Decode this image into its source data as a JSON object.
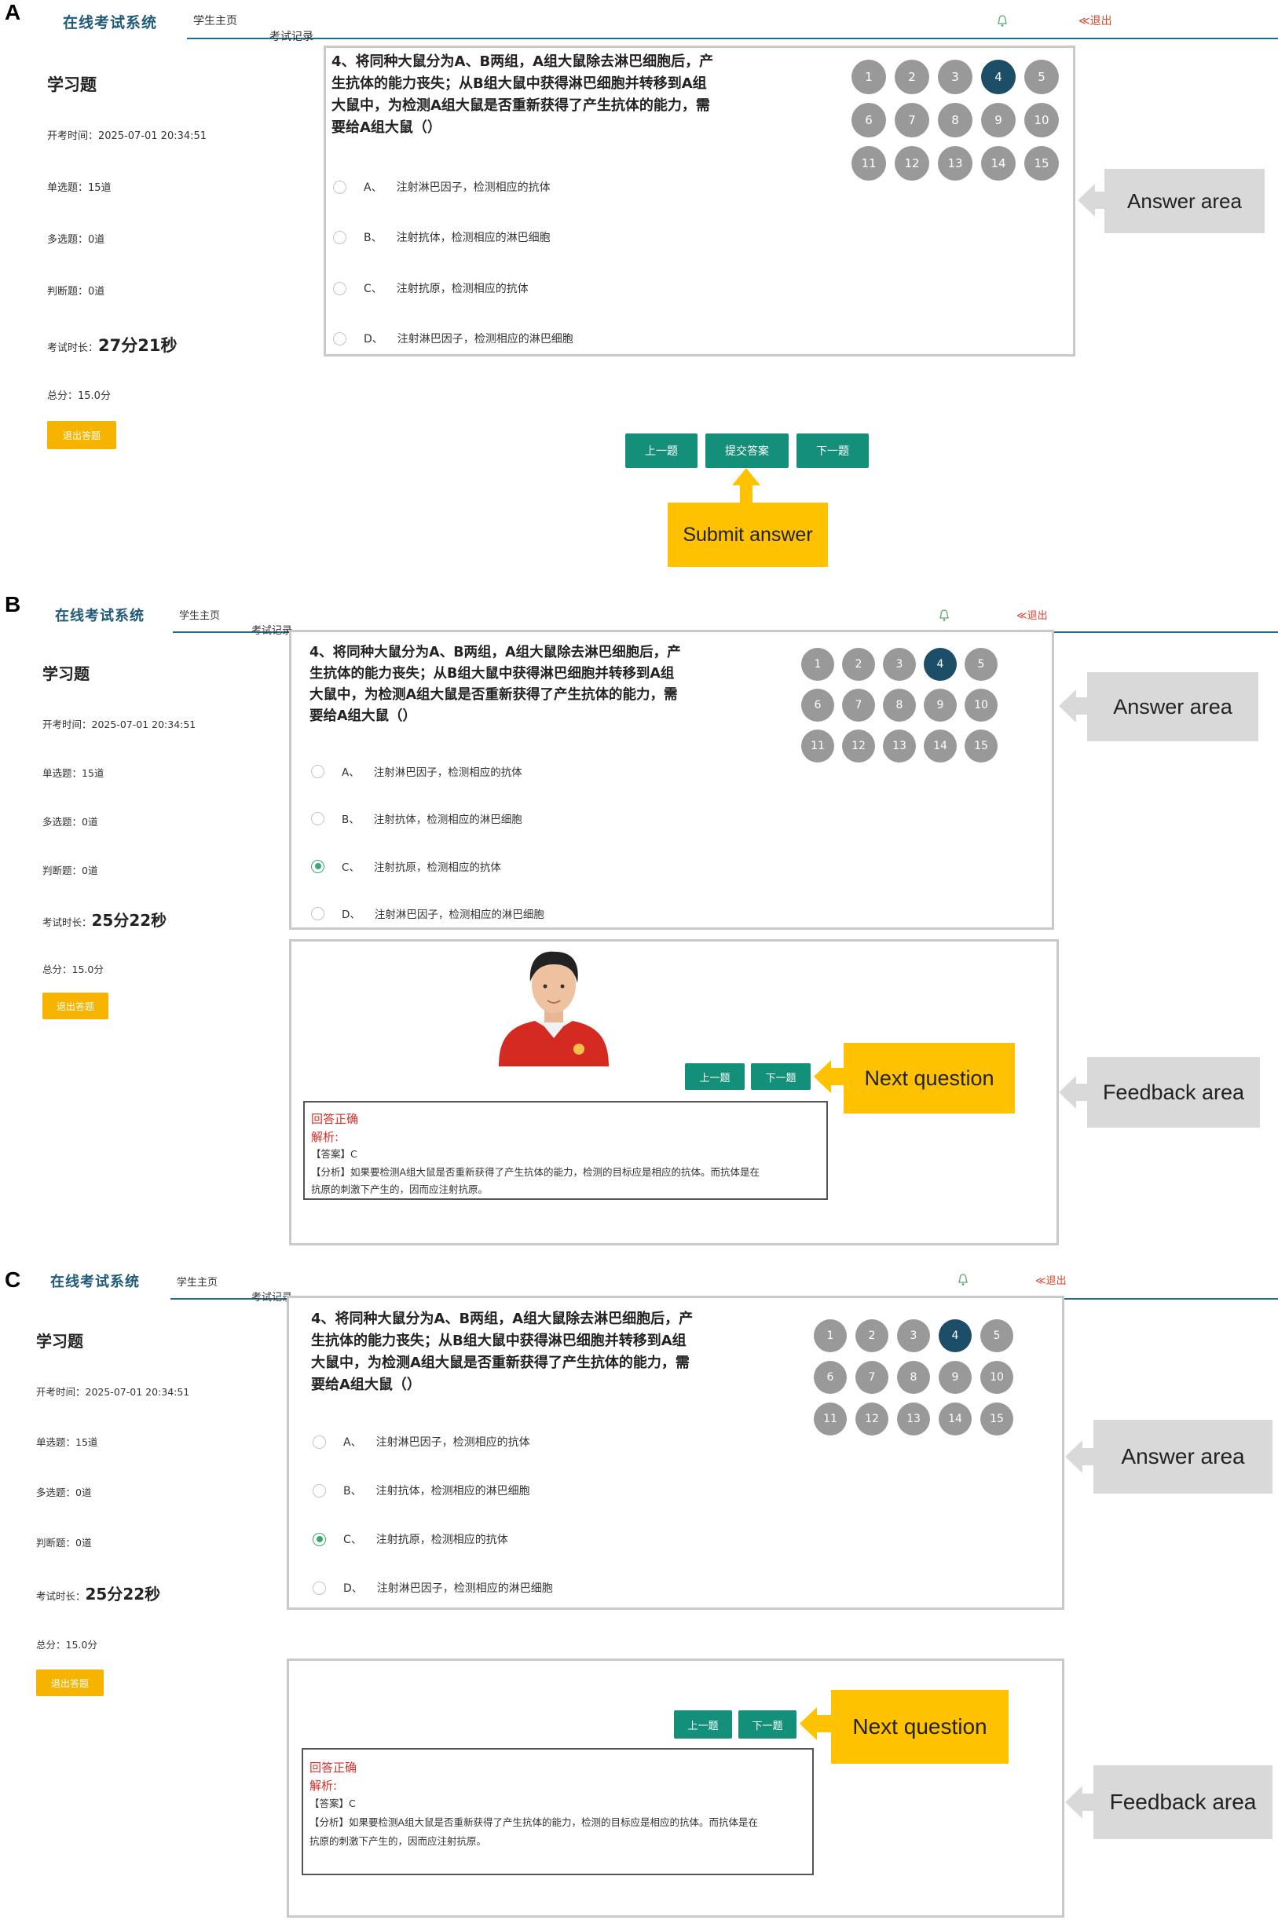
{
  "panels": [
    {
      "letter": "A",
      "header": {
        "logo": "在线考试系统",
        "tabs": [
          "学生主页",
          "考试记录"
        ],
        "active_tab": 0,
        "exit": "≪退出"
      },
      "sidebar": {
        "title": "学习题",
        "start_time": "开考时间：2025-07-01 20:34:51",
        "single": "单选题：15道",
        "multiple": "多选题：0道",
        "judge": "判断题：0道",
        "duration_label": "考试时长：",
        "duration_value": "27分21秒",
        "total": "总分：15.0分",
        "quit_button": "退出答题"
      },
      "question": {
        "lines": [
          "4、将同种大鼠分为A、B两组，A组大鼠除去淋巴细胞后，产",
          "生抗体的能力丧失；从B组大鼠中获得淋巴细胞并转移到A组",
          "大鼠中，为检测A组大鼠是否重新获得了产生抗体的能力，需",
          "要给A组大鼠（）"
        ],
        "options": [
          {
            "letter": "A、",
            "text": "注射淋巴因子，检测相应的抗体",
            "checked": false
          },
          {
            "letter": "B、",
            "text": "注射抗体，检测相应的淋巴细胞",
            "checked": false
          },
          {
            "letter": "C、",
            "text": "注射抗原，检测相应的抗体",
            "checked": false
          },
          {
            "letter": "D、",
            "text": "注射淋巴因子，检测相应的淋巴细胞",
            "checked": false
          }
        ]
      },
      "numbers": [
        "1",
        "2",
        "3",
        "4",
        "5",
        "6",
        "7",
        "8",
        "9",
        "10",
        "11",
        "12",
        "13",
        "14",
        "15"
      ],
      "current_number": "4",
      "buttons": [
        "上一题",
        "提交答案",
        "下一题"
      ],
      "callouts": {
        "answer_area": "Answer area",
        "submit": "Submit answer"
      }
    },
    {
      "letter": "B",
      "header": {
        "logo": "在线考试系统",
        "tabs": [
          "学生主页",
          "考试记录"
        ],
        "active_tab": 0,
        "exit": "≪退出"
      },
      "sidebar": {
        "title": "学习题",
        "start_time": "开考时间：2025-07-01 20:34:51",
        "single": "单选题：15道",
        "multiple": "多选题：0道",
        "judge": "判断题：0道",
        "duration_label": "考试时长：",
        "duration_value": "25分22秒",
        "total": "总分：15.0分",
        "quit_button": "退出答题"
      },
      "question": {
        "lines": [
          "4、将同种大鼠分为A、B两组，A组大鼠除去淋巴细胞后，产",
          "生抗体的能力丧失；从B组大鼠中获得淋巴细胞并转移到A组",
          "大鼠中，为检测A组大鼠是否重新获得了产生抗体的能力，需",
          "要给A组大鼠（）"
        ],
        "options": [
          {
            "letter": "A、",
            "text": "注射淋巴因子，检测相应的抗体",
            "checked": false
          },
          {
            "letter": "B、",
            "text": "注射抗体，检测相应的淋巴细胞",
            "checked": false
          },
          {
            "letter": "C、",
            "text": "注射抗原，检测相应的抗体",
            "checked": true
          },
          {
            "letter": "D、",
            "text": "注射淋巴因子，检测相应的淋巴细胞",
            "checked": false
          }
        ]
      },
      "numbers": [
        "1",
        "2",
        "3",
        "4",
        "5",
        "6",
        "7",
        "8",
        "9",
        "10",
        "11",
        "12",
        "13",
        "14",
        "15"
      ],
      "current_number": "4",
      "buttons": [
        "上一题",
        "下一题"
      ],
      "feedback": {
        "correct": "回答正确",
        "analysis_label": "解析:",
        "answer": "【答案】C",
        "analysis_1": "【分析】如果要检测A组大鼠是否重新获得了产生抗体的能力，检测的目标应是相应的抗体。而抗体是在",
        "analysis_2": "抗原的刺激下产生的，因而应注射抗原。"
      },
      "callouts": {
        "answer_area": "Answer area",
        "next": "Next question",
        "feedback_area": "Feedback area"
      }
    },
    {
      "letter": "C",
      "header": {
        "logo": "在线考试系统",
        "tabs": [
          "学生主页",
          "考试记录"
        ],
        "active_tab": 0,
        "exit": "≪退出"
      },
      "sidebar": {
        "title": "学习题",
        "start_time": "开考时间：2025-07-01 20:34:51",
        "single": "单选题：15道",
        "multiple": "多选题：0道",
        "judge": "判断题：0道",
        "duration_label": "考试时长：",
        "duration_value": "25分22秒",
        "total": "总分：15.0分",
        "quit_button": "退出答题"
      },
      "question": {
        "lines": [
          "4、将同种大鼠分为A、B两组，A组大鼠除去淋巴细胞后，产",
          "生抗体的能力丧失；从B组大鼠中获得淋巴细胞并转移到A组",
          "大鼠中，为检测A组大鼠是否重新获得了产生抗体的能力，需",
          "要给A组大鼠（）"
        ],
        "options": [
          {
            "letter": "A、",
            "text": "注射淋巴因子，检测相应的抗体",
            "checked": false
          },
          {
            "letter": "B、",
            "text": "注射抗体，检测相应的淋巴细胞",
            "checked": false
          },
          {
            "letter": "C、",
            "text": "注射抗原，检测相应的抗体",
            "checked": true
          },
          {
            "letter": "D、",
            "text": "注射淋巴因子，检测相应的淋巴细胞",
            "checked": false
          }
        ]
      },
      "numbers": [
        "1",
        "2",
        "3",
        "4",
        "5",
        "6",
        "7",
        "8",
        "9",
        "10",
        "11",
        "12",
        "13",
        "14",
        "15"
      ],
      "current_number": "4",
      "buttons": [
        "上一题",
        "下一题"
      ],
      "feedback": {
        "correct": "回答正确",
        "analysis_label": "解析:",
        "answer": "【答案】C",
        "analysis_1": "【分析】如果要检测A组大鼠是否重新获得了产生抗体的能力，检测的目标应是相应的抗体。而抗体是在",
        "analysis_2": "抗原的刺激下产生的，因而应注射抗原。"
      },
      "callouts": {
        "answer_area": "Answer area",
        "next": "Next question",
        "feedback_area": "Feedback area"
      }
    }
  ],
  "colors": {
    "accent_teal": "#14907a",
    "active_number": "#1c4e67",
    "callout_yellow": "#ffc200",
    "callout_gray": "#d9d9d9",
    "exit_red": "#e0452b"
  }
}
